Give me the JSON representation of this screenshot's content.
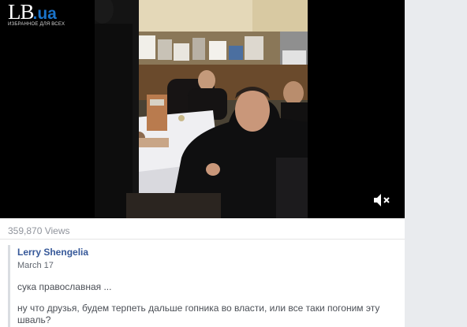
{
  "video": {
    "logo_main": "LB",
    "logo_suffix": ".ua",
    "logo_tagline": "ИЗБРАННОЕ ДЛЯ ВСЕХ",
    "mute_icon": "speaker-muted-icon"
  },
  "stats": {
    "views": "359,870 Views"
  },
  "post": {
    "author": "Lerry Shengelia",
    "date": "March 17",
    "paragraphs": [
      "сука православная ...",
      "ну что друзья, будем терпеть дальше гопника во власти, или все таки погоним эту шваль?"
    ]
  },
  "colors": {
    "page_bg": "#e9ebee",
    "card_bg": "#ffffff",
    "link": "#365899",
    "muted_text": "#90949c",
    "body_text": "#4b4f56",
    "logo_accent": "#1a73c9"
  }
}
